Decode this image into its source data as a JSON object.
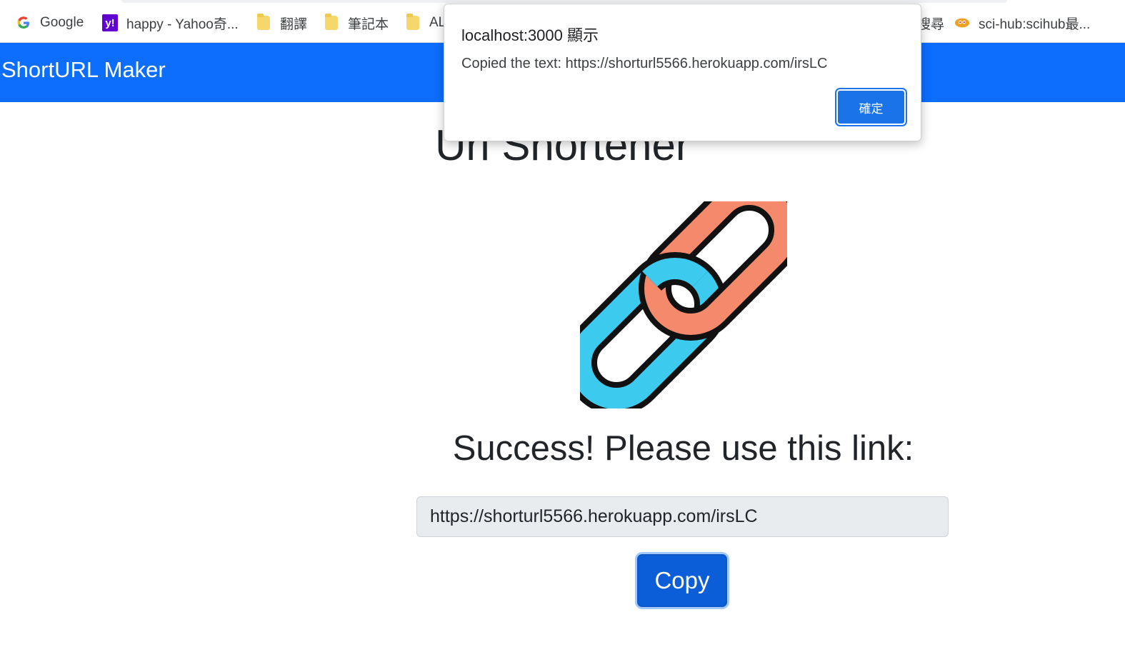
{
  "bookmarks": [
    {
      "label": "Google",
      "icon": "google-icon"
    },
    {
      "label": "happy - Yahoo奇...",
      "icon": "yahoo-icon"
    },
    {
      "label": "翻譯",
      "icon": "folder-icon"
    },
    {
      "label": "筆記本",
      "icon": "folder-icon"
    },
    {
      "label": "AL",
      "icon": "folder-icon"
    },
    {
      "label": "搜尋",
      "icon": "none"
    },
    {
      "label": "sci-hub:scihub最...",
      "icon": "scihub-icon"
    }
  ],
  "navbar": {
    "brand": "ShortURL Maker",
    "color": "#0d6efd"
  },
  "main": {
    "title": "Url Shortener",
    "success_text": "Success! Please use this link:",
    "short_url": "https://shorturl5566.herokuapp.com/irsLC",
    "copy_label": "Copy"
  },
  "dialog": {
    "title": "localhost:3000 顯示",
    "message": "Copied the text: https://shorturl5566.herokuapp.com/irsLC",
    "ok_label": "確定"
  }
}
